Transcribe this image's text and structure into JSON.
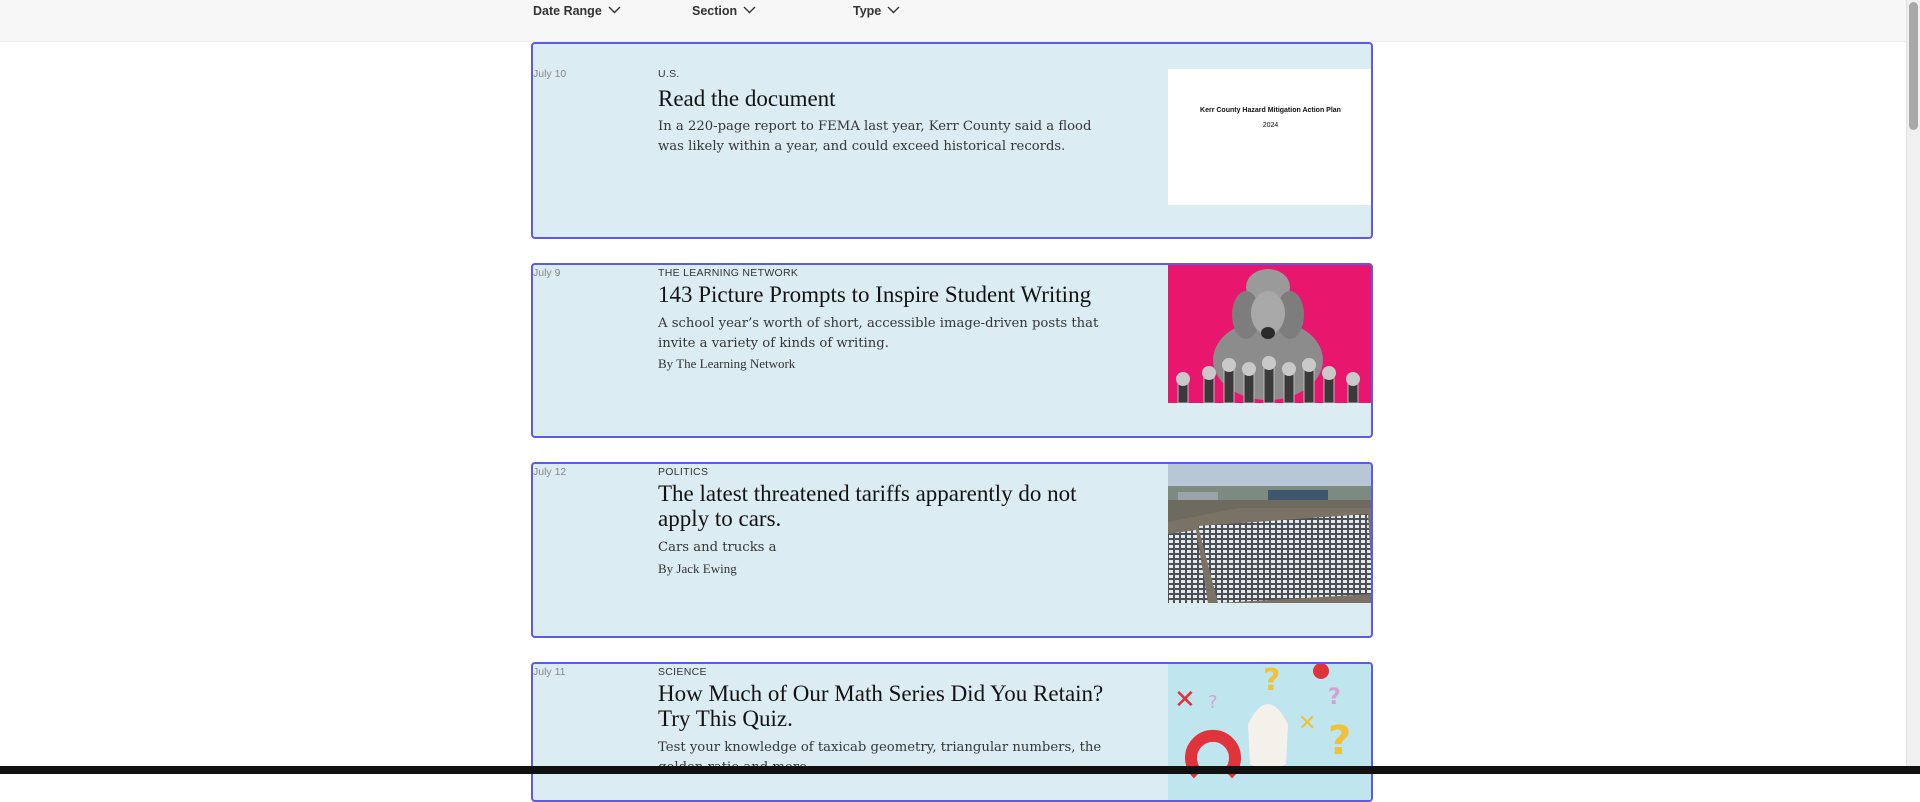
{
  "filters": {
    "date_range": "Date Range",
    "section": "Section",
    "type": "Type"
  },
  "results": [
    {
      "date": "July 10",
      "section": "U.S.",
      "headline": "Read the document",
      "summary": "In a 220-page report to FEMA last year, Kerr County said a flood was likely within a year, and could exceed historical records.",
      "byline": "",
      "image": {
        "kind": "document",
        "doc_title": "Kerr County Hazard Mitigation Action Plan",
        "doc_year": "2024"
      }
    },
    {
      "date": "July 9",
      "section": "THE LEARNING NETWORK",
      "headline": "143 Picture Prompts to Inspire Student Writing",
      "summary": "A school year’s worth of short, accessible image-driven posts that invite a variety of kinds of writing.",
      "byline": "By The Learning Network",
      "image": {
        "kind": "poodle-with-microphones",
        "background": "#e8176d"
      }
    },
    {
      "date": "July 12",
      "section": "POLITICS",
      "headline": "The latest threatened tariffs apparently do not apply to cars.",
      "summary": "Cars and trucks a",
      "byline": "By Jack Ewing",
      "image": {
        "kind": "car-lot-aerial"
      }
    },
    {
      "date": "July 11",
      "section": "SCIENCE",
      "headline": "How Much of Our Math Series Did You Retain? Try This Quiz.",
      "summary": "Test your knowledge of taxicab geometry, triangular numbers, the golden ratio and more.",
      "byline": "",
      "image": {
        "kind": "math-quiz-illustration",
        "background": "#bfe6ef"
      }
    }
  ],
  "colors": {
    "card_background": "#dcecf3",
    "card_border": "#5b5be6",
    "filter_bar": "#f7f7f7"
  }
}
